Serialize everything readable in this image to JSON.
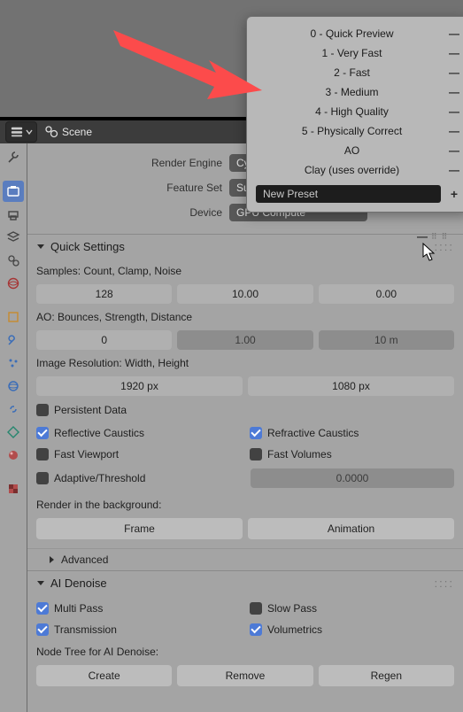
{
  "header": {
    "scene_label": "Scene"
  },
  "properties": {
    "render_engine_label": "Render Engine",
    "render_engine_value": "Cycles",
    "feature_set_label": "Feature Set",
    "feature_set_value": "Supported",
    "device_label": "Device",
    "device_value": "GPU Compute"
  },
  "quick": {
    "title": "Quick Settings",
    "samples_caption": "Samples: Count, Clamp, Noise",
    "samples": {
      "count": "128",
      "clamp": "10.00",
      "noise": "0.00"
    },
    "ao_caption": "AO: Bounces, Strength, Distance",
    "ao": {
      "bounces": "0",
      "strength": "1.00",
      "distance": "10 m"
    },
    "res_caption": "Image Resolution: Width, Height",
    "res": {
      "width": "1920 px",
      "height": "1080 px"
    },
    "persistent_label": "Persistent Data",
    "refl_caustics_label": "Reflective Caustics",
    "refr_caustics_label": "Refractive Caustics",
    "fast_viewport_label": "Fast Viewport",
    "fast_volumes_label": "Fast Volumes",
    "adaptive_label": "Adaptive/Threshold",
    "adaptive_value": "0.0000",
    "render_bg_caption": "Render in the background:",
    "frame_btn": "Frame",
    "animation_btn": "Animation",
    "advanced_label": "Advanced"
  },
  "ai": {
    "title": "AI Denoise",
    "multi_pass": "Multi Pass",
    "slow_pass": "Slow Pass",
    "transmission": "Transmission",
    "volumetrics": "Volumetrics",
    "nodetree_caption": "Node Tree for AI Denoise:",
    "create": "Create",
    "remove": "Remove",
    "regen": "Regen"
  },
  "popup": {
    "items": [
      "0 - Quick Preview",
      "1 - Very Fast",
      "2 - Fast",
      "3 - Medium",
      "4 - High Quality",
      "5 - Physically Correct",
      "AO",
      "Clay (uses override)"
    ],
    "new_preset": "New Preset"
  }
}
